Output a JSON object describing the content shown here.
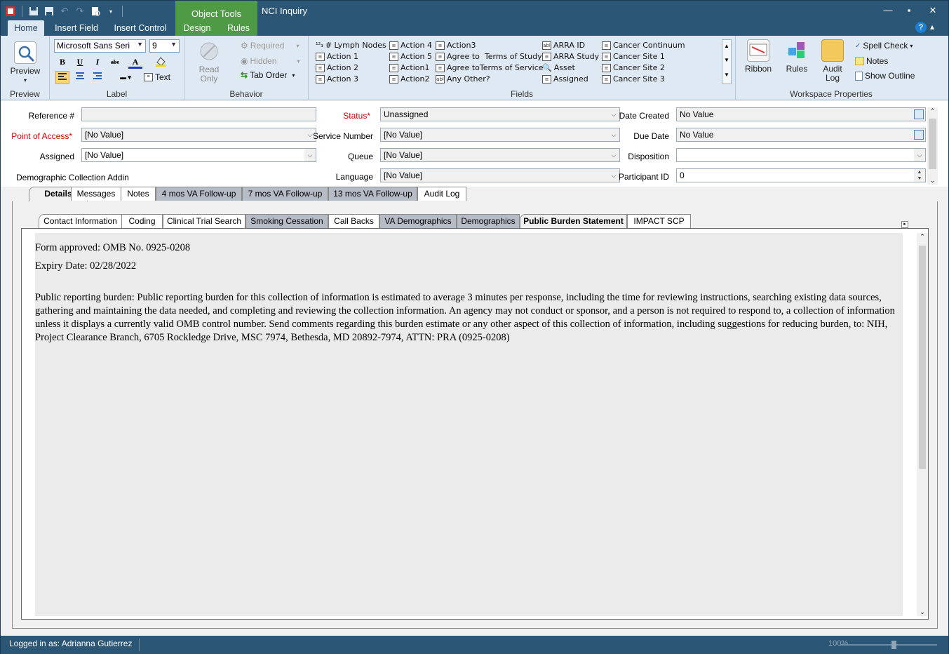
{
  "window": {
    "title": "NCI Inquiry",
    "context_tab_group": "Object Tools"
  },
  "ribbon_tabs": [
    "Home",
    "Insert Field",
    "Insert Control",
    "Design",
    "Rules"
  ],
  "ribbon": {
    "preview": {
      "button": "Preview",
      "group": "Preview"
    },
    "label": {
      "font_name": "Microsoft Sans Seri",
      "font_size": "9",
      "text_button": "Text",
      "group": "Label"
    },
    "behavior": {
      "read_only": "Read Only",
      "required": "Required",
      "hidden": "Hidden",
      "tab_order": "Tab Order",
      "group": "Behavior"
    },
    "fields": {
      "group": "Fields",
      "col1": [
        "# Lymph Nodes",
        "Action 1",
        "Action 2",
        "Action 3"
      ],
      "col2": [
        "Action 4",
        "Action 5",
        "Action1",
        "Action2"
      ],
      "col3": [
        "Action3",
        "Agree to  Terms of Study",
        "Agree toTerms of Service",
        "Any Other?"
      ],
      "col4": [
        "ARRA ID",
        "ARRA Study",
        "Asset",
        "Assigned"
      ],
      "col5": [
        "Cancer Continuum",
        "Cancer Site 1",
        "Cancer Site 2",
        "Cancer Site 3"
      ]
    },
    "workspace": {
      "ribbon": "Ribbon",
      "rules": "Rules",
      "audit_log": "Audit Log",
      "spell_check": "Spell Check",
      "notes": "Notes",
      "show_outline": "Show Outline",
      "group": "Workspace Properties"
    }
  },
  "form": {
    "reference_label": "Reference #",
    "reference_value": "",
    "status_label": "Status*",
    "status_value": "Unassigned",
    "date_created_label": "Date Created",
    "date_created_value": "No Value",
    "poa_label": "Point of Access*",
    "poa_value": "[No Value]",
    "service_label": "Service Number",
    "service_value": "[No Value]",
    "due_label": "Due Date",
    "due_value": "No Value",
    "assigned_label": "Assigned",
    "assigned_value": "[No Value]",
    "queue_label": "Queue",
    "queue_value": "[No Value]",
    "disposition_label": "Disposition",
    "disposition_value": "",
    "demo_label": "Demographic Collection Addin",
    "language_label": "Language",
    "language_value": "[No Value]",
    "participant_label": "Participant ID",
    "participant_value": "0"
  },
  "main_tabs": [
    "Details",
    "Messages",
    "Notes",
    "4 mos VA Follow-up",
    "7 mos VA Follow-up",
    "13 mos VA Follow-up",
    "Audit Log"
  ],
  "sub_tabs": [
    "Contact Information",
    "Coding",
    "Clinical Trial Search",
    "Smoking Cessation",
    "Call Backs",
    "VA Demographics",
    "Demographics",
    "Public Burden Statement",
    "IMPACT SCP"
  ],
  "document": {
    "line1": "Form approved: OMB No. 0925-0208",
    "line2": "Expiry Date: 02/28/2022",
    "paragraph": "Public reporting burden: Public reporting burden for this collection of information is estimated to average 3 minutes per response, including the time for reviewing instructions, searching existing data sources, gathering and maintaining the data needed, and completing and reviewing the collection information. An agency may not conduct or sponsor, and a person is not required to respond to, a collection of information unless it displays a currently valid OMB control number. Send comments regarding this burden estimate or any other aspect of this collection of information, including suggestions for reducing burden, to: NIH, Project Clearance Branch, 6705 Rockledge Drive, MSC 7974, Bethesda, MD 20892-7974, ATTN: PRA (0925-0208)"
  },
  "status": {
    "logged_in": "Logged in as: Adrianna Gutierrez",
    "zoom": "100%"
  },
  "colors": {
    "titlebar": "#2c5675",
    "context_group": "#4e9a45",
    "ribbon": "#dfe9f3",
    "required_label": "#d40000"
  }
}
